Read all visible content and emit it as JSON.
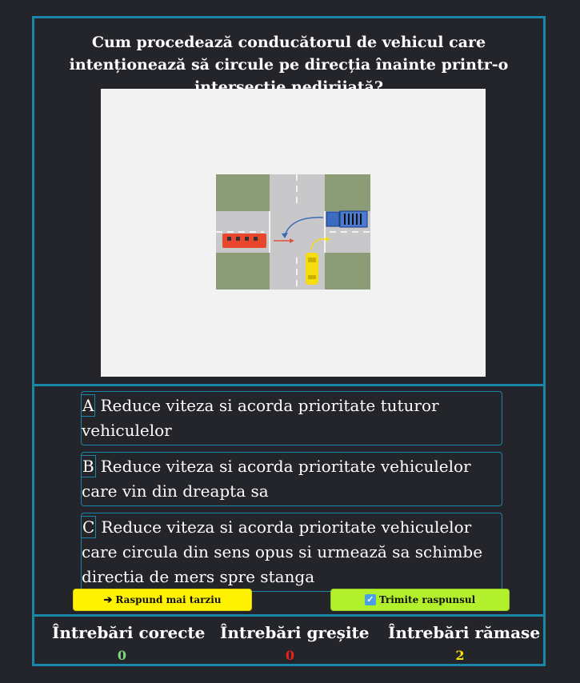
{
  "question": {
    "text": "Cum procedează conducătorul de vehicul care intenționează să circule pe direcția înainte printr-o intersecție nedirijată?"
  },
  "answers": [
    {
      "letter": "A",
      "text": "Reduce viteza si acorda prioritate tuturor vehiculelor"
    },
    {
      "letter": "B",
      "text": "Reduce viteza si acorda prioritate vehiculelor care vin din dreapta sa"
    },
    {
      "letter": "C",
      "text": "Reduce viteza si acorda prioritate vehiculelor care circula din sens opus si urmează sa schimbe directia de mers spre stanga"
    }
  ],
  "buttons": {
    "later": {
      "icon": "➔",
      "label": "Raspund mai tarziu"
    },
    "submit": {
      "icon": "✓",
      "label": "Trimite raspunsul"
    }
  },
  "stats": {
    "correct": {
      "label": "Întrebări corecte",
      "value": "0",
      "color": "#7ed67e"
    },
    "wrong": {
      "label": "Întrebări greșite",
      "value": "0",
      "color": "#e8201e"
    },
    "remaining": {
      "label": "Întrebări rămase",
      "value": "2",
      "color": "#ffe500"
    }
  },
  "colors": {
    "border": "#1a86a8",
    "background": "#23252a",
    "later_button": "#fff200",
    "submit_button": "#b2f02c"
  }
}
